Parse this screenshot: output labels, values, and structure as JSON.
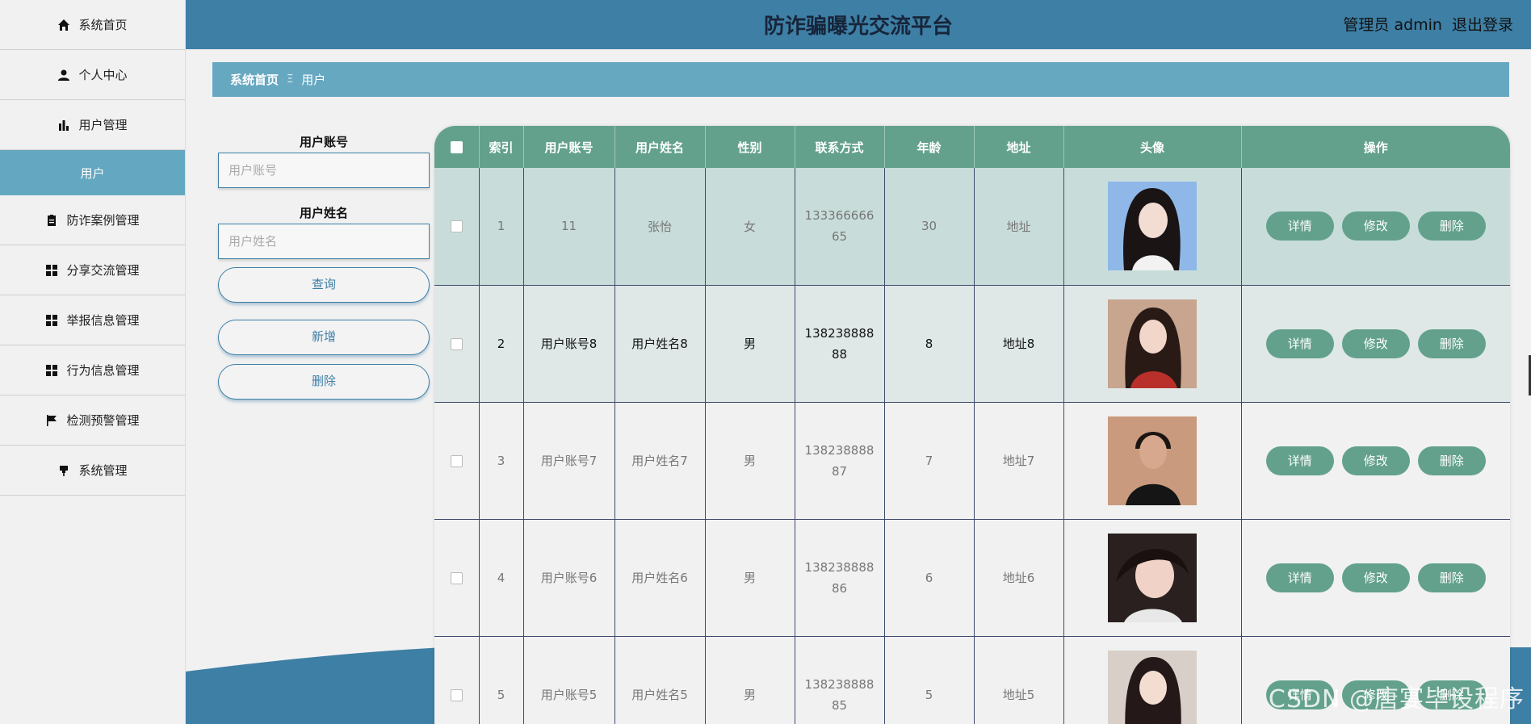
{
  "header": {
    "title": "防诈骗曝光交流平台",
    "user_label": "管理员 admin",
    "logout_label": "退出登录"
  },
  "sidebar": {
    "items": [
      {
        "label": "系统首页",
        "icon": "home-icon"
      },
      {
        "label": "个人中心",
        "icon": "person-icon"
      },
      {
        "label": "用户管理",
        "icon": "bar-chart-icon"
      },
      {
        "label": "用户",
        "icon": ""
      },
      {
        "label": "防诈案例管理",
        "icon": "clipboard-icon"
      },
      {
        "label": "分享交流管理",
        "icon": "grid-icon"
      },
      {
        "label": "举报信息管理",
        "icon": "grid-icon"
      },
      {
        "label": "行为信息管理",
        "icon": "grid-icon"
      },
      {
        "label": "检测预警管理",
        "icon": "flag-icon"
      },
      {
        "label": "系统管理",
        "icon": "pin-icon"
      }
    ]
  },
  "breadcrumb": {
    "home": "系统首页",
    "separator": "Ξ",
    "current": "用户"
  },
  "search": {
    "account_label": "用户账号",
    "account_placeholder": "用户账号",
    "name_label": "用户姓名",
    "name_placeholder": "用户姓名",
    "query_button": "查询",
    "add_button": "新增",
    "delete_button": "删除"
  },
  "table": {
    "columns": [
      "索引",
      "用户账号",
      "用户姓名",
      "性别",
      "联系方式",
      "年龄",
      "地址",
      "头像",
      "操作"
    ],
    "rows": [
      {
        "index": "1",
        "account": "11",
        "name": "张怡",
        "gender": "女",
        "phone": "13336666665",
        "age": "30",
        "address": "地址"
      },
      {
        "index": "2",
        "account": "用户账号8",
        "name": "用户姓名8",
        "gender": "男",
        "phone": "13823888888",
        "age": "8",
        "address": "地址8"
      },
      {
        "index": "3",
        "account": "用户账号7",
        "name": "用户姓名7",
        "gender": "男",
        "phone": "13823888887",
        "age": "7",
        "address": "地址7"
      },
      {
        "index": "4",
        "account": "用户账号6",
        "name": "用户姓名6",
        "gender": "男",
        "phone": "13823888886",
        "age": "6",
        "address": "地址6"
      },
      {
        "index": "5",
        "account": "用户账号5",
        "name": "用户姓名5",
        "gender": "男",
        "phone": "13823888885",
        "age": "5",
        "address": "地址5"
      }
    ],
    "actions": {
      "detail": "详情",
      "edit": "修改",
      "delete": "删除"
    }
  },
  "colors": {
    "header_bg": "#3e7fa5",
    "breadcrumb_bg": "#67a8c1",
    "table_accent": "#63a18d",
    "sidebar_active": "#64a7c0"
  },
  "watermark": "CSDN @唐宴毕设程序"
}
